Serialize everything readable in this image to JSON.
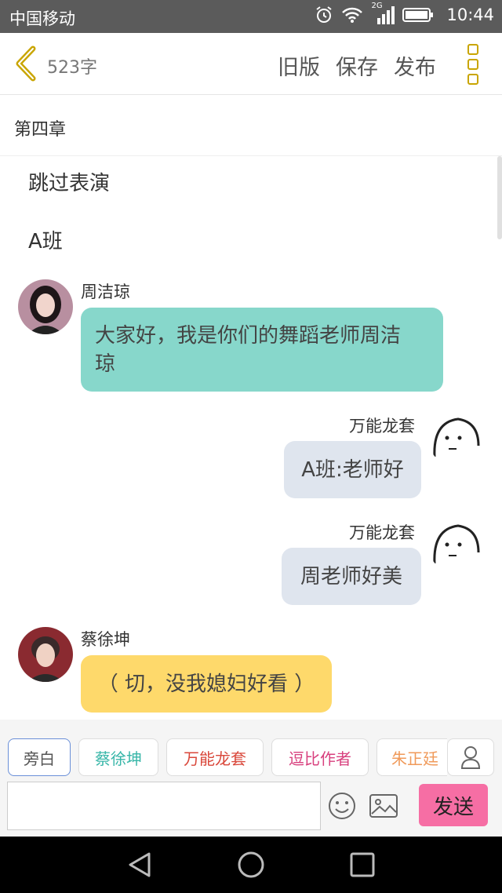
{
  "status_bar": {
    "carrier": "中国移动",
    "network": "2G",
    "time": "10:44"
  },
  "toolbar": {
    "word_count": "523字",
    "old_version": "旧版",
    "save": "保存",
    "publish": "发布"
  },
  "chapter": {
    "title": "第四章"
  },
  "story": {
    "lines": [
      "跳过表演",
      "A班"
    ],
    "messages": [
      {
        "sender": "周洁琼",
        "text_line1": "大家好，我是你们的舞蹈老师周洁",
        "text_line2": "琼",
        "side": "left",
        "color": "#87d7cb"
      },
      {
        "sender": "万能龙套",
        "text": "A班:老师好",
        "side": "right",
        "color": "#dfe5ee"
      },
      {
        "sender": "万能龙套",
        "text": "周老师好美",
        "side": "right",
        "color": "#dfe5ee"
      },
      {
        "sender": "蔡徐坤",
        "text": "（ 切，没我媳妇好看 ）",
        "side": "left",
        "color": "#fed96b"
      }
    ]
  },
  "characters": [
    {
      "label": "旁白",
      "color": "#555555"
    },
    {
      "label": "蔡徐坤",
      "color": "#37b6a8"
    },
    {
      "label": "万能龙套",
      "color": "#d9473a"
    },
    {
      "label": "逗比作者",
      "color": "#d8407e"
    },
    {
      "label": "朱正廷",
      "color": "#f09a5a"
    }
  ],
  "composer": {
    "input_value": "",
    "send_label": "发送"
  },
  "accent_color": "#c9a500"
}
